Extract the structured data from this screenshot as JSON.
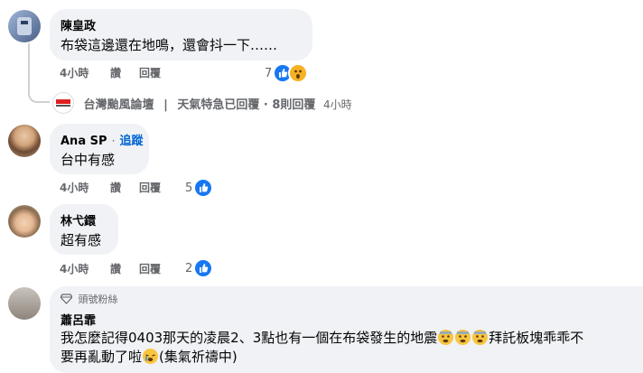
{
  "comments": [
    {
      "author": "陳皇政",
      "text": "布袋這邊還在地鳴，還會抖一下……",
      "time": "4小時",
      "like_label": "讚",
      "reply_label": "回覆",
      "reaction_count": "7",
      "reactions": [
        "like-icon",
        "wow-icon"
      ],
      "reply_summary": {
        "page_name": "台灣颱風論壇",
        "separator": "|",
        "status": "天氣特急已回覆",
        "dot": "·",
        "replies": "8則回覆",
        "time": "4小時"
      }
    },
    {
      "author": "Ana SP",
      "author_dot": "·",
      "follow_label": "追蹤",
      "text": "台中有感",
      "time": "4小時",
      "like_label": "讚",
      "reply_label": "回覆",
      "reaction_count": "5",
      "reactions": [
        "like-icon"
      ]
    },
    {
      "author": "林弋鐶",
      "text": "超有感",
      "time": "4小時",
      "like_label": "讚",
      "reply_label": "回覆",
      "reaction_count": "2",
      "reactions": [
        "like-icon"
      ]
    },
    {
      "badge": "頭號粉絲",
      "author": "蕭呂霏",
      "text_line1a": "我怎麼記得0403那天的凌晨2、3點也有一個在布袋發生的地震",
      "text_line1b": "拜託板塊乖乖不",
      "text_line2a": "要再亂動了啦",
      "text_line2b": "(集氣祈禱中)"
    }
  ],
  "colors": {
    "accent": "#1877f2",
    "bubble": "#f0f2f5",
    "meta": "#65676b",
    "follow": "#0064d1"
  }
}
